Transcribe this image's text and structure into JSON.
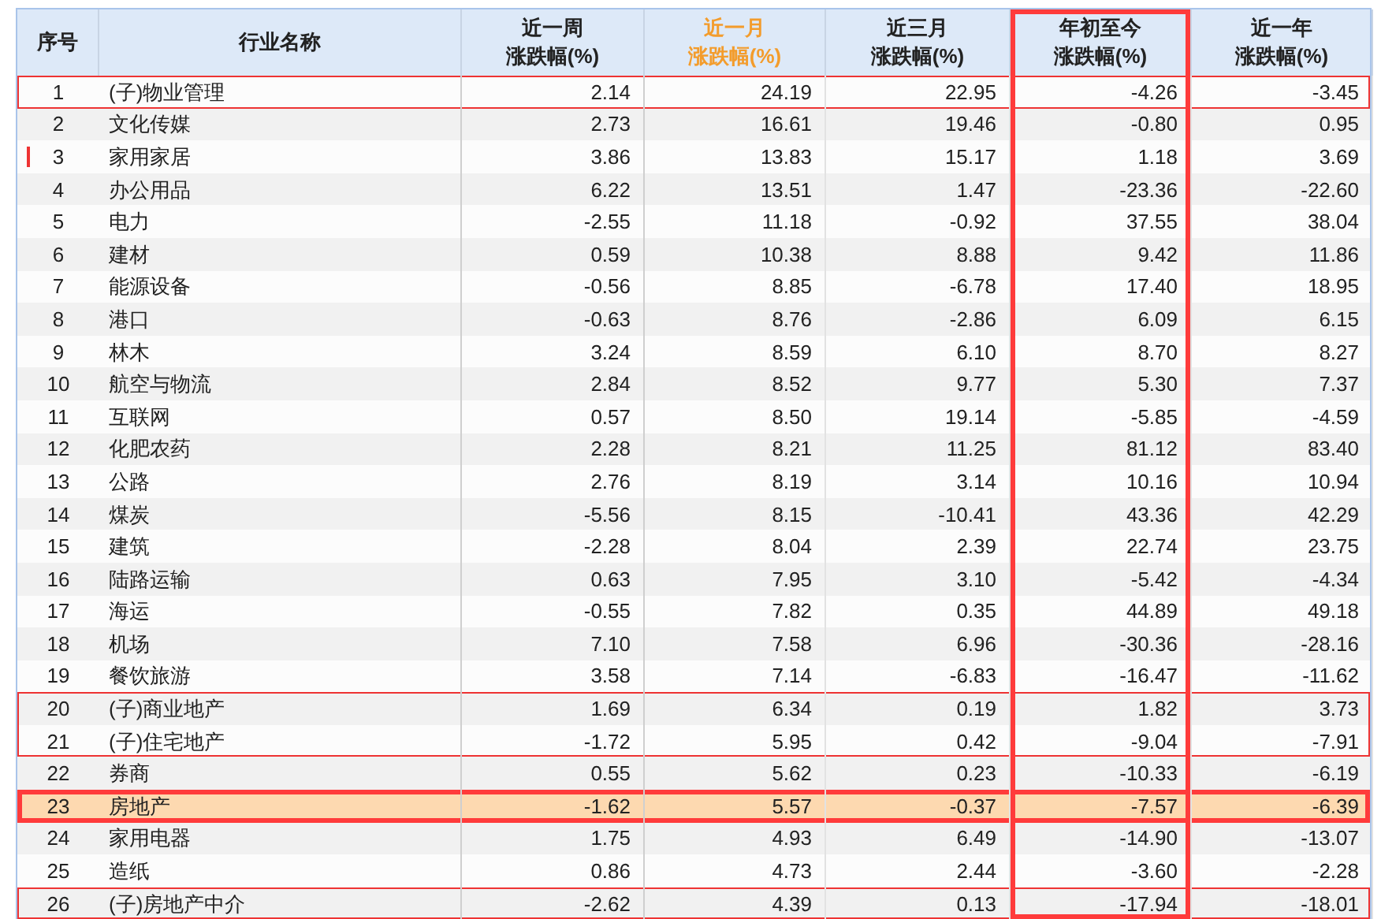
{
  "columns": [
    {
      "label": "序号",
      "sorted": false,
      "outlined": false
    },
    {
      "label": "行业名称",
      "sorted": false,
      "outlined": false
    },
    {
      "label": "近一周",
      "unit": "涨跌幅(%)",
      "sorted": false,
      "outlined": false
    },
    {
      "label": "近一月",
      "unit": "涨跌幅(%)",
      "sorted": true,
      "outlined": false
    },
    {
      "label": "近三月",
      "unit": "涨跌幅(%)",
      "sorted": false,
      "outlined": false
    },
    {
      "label": "年初至今",
      "unit": "涨跌幅(%)",
      "sorted": false,
      "outlined": true
    },
    {
      "label": "近一年",
      "unit": "涨跌幅(%)",
      "sorted": false,
      "outlined": false
    }
  ],
  "rows": [
    {
      "cells": [
        "1",
        "(子)物业管理",
        "2.14",
        "24.19",
        "22.95",
        "-4.26",
        "-3.45"
      ],
      "selected": false,
      "outlined": true,
      "bold_outline": false,
      "marked": false
    },
    {
      "cells": [
        "2",
        "文化传媒",
        "2.73",
        "16.61",
        "19.46",
        "-0.80",
        "0.95"
      ],
      "selected": false,
      "outlined": false,
      "bold_outline": false,
      "marked": false
    },
    {
      "cells": [
        "3",
        "家用家居",
        "3.86",
        "13.83",
        "15.17",
        "1.18",
        "3.69"
      ],
      "selected": false,
      "outlined": false,
      "bold_outline": false,
      "marked": true
    },
    {
      "cells": [
        "4",
        "办公用品",
        "6.22",
        "13.51",
        "1.47",
        "-23.36",
        "-22.60"
      ],
      "selected": false,
      "outlined": false,
      "bold_outline": false,
      "marked": false
    },
    {
      "cells": [
        "5",
        "电力",
        "-2.55",
        "11.18",
        "-0.92",
        "37.55",
        "38.04"
      ],
      "selected": false,
      "outlined": false,
      "bold_outline": false,
      "marked": false
    },
    {
      "cells": [
        "6",
        "建材",
        "0.59",
        "10.38",
        "8.88",
        "9.42",
        "11.86"
      ],
      "selected": false,
      "outlined": false,
      "bold_outline": false,
      "marked": false
    },
    {
      "cells": [
        "7",
        "能源设备",
        "-0.56",
        "8.85",
        "-6.78",
        "17.40",
        "18.95"
      ],
      "selected": false,
      "outlined": false,
      "bold_outline": false,
      "marked": false
    },
    {
      "cells": [
        "8",
        "港口",
        "-0.63",
        "8.76",
        "-2.86",
        "6.09",
        "6.15"
      ],
      "selected": false,
      "outlined": false,
      "bold_outline": false,
      "marked": false
    },
    {
      "cells": [
        "9",
        "林木",
        "3.24",
        "8.59",
        "6.10",
        "8.70",
        "8.27"
      ],
      "selected": false,
      "outlined": false,
      "bold_outline": false,
      "marked": false
    },
    {
      "cells": [
        "10",
        "航空与物流",
        "2.84",
        "8.52",
        "9.77",
        "5.30",
        "7.37"
      ],
      "selected": false,
      "outlined": false,
      "bold_outline": false,
      "marked": false
    },
    {
      "cells": [
        "11",
        "互联网",
        "0.57",
        "8.50",
        "19.14",
        "-5.85",
        "-4.59"
      ],
      "selected": false,
      "outlined": false,
      "bold_outline": false,
      "marked": false
    },
    {
      "cells": [
        "12",
        "化肥农药",
        "2.28",
        "8.21",
        "11.25",
        "81.12",
        "83.40"
      ],
      "selected": false,
      "outlined": false,
      "bold_outline": false,
      "marked": false
    },
    {
      "cells": [
        "13",
        "公路",
        "2.76",
        "8.19",
        "3.14",
        "10.16",
        "10.94"
      ],
      "selected": false,
      "outlined": false,
      "bold_outline": false,
      "marked": false
    },
    {
      "cells": [
        "14",
        "煤炭",
        "-5.56",
        "8.15",
        "-10.41",
        "43.36",
        "42.29"
      ],
      "selected": false,
      "outlined": false,
      "bold_outline": false,
      "marked": false
    },
    {
      "cells": [
        "15",
        "建筑",
        "-2.28",
        "8.04",
        "2.39",
        "22.74",
        "23.75"
      ],
      "selected": false,
      "outlined": false,
      "bold_outline": false,
      "marked": false
    },
    {
      "cells": [
        "16",
        "陆路运输",
        "0.63",
        "7.95",
        "3.10",
        "-5.42",
        "-4.34"
      ],
      "selected": false,
      "outlined": false,
      "bold_outline": false,
      "marked": false
    },
    {
      "cells": [
        "17",
        "海运",
        "-0.55",
        "7.82",
        "0.35",
        "44.89",
        "49.18"
      ],
      "selected": false,
      "outlined": false,
      "bold_outline": false,
      "marked": false
    },
    {
      "cells": [
        "18",
        "机场",
        "7.10",
        "7.58",
        "6.96",
        "-30.36",
        "-28.16"
      ],
      "selected": false,
      "outlined": false,
      "bold_outline": false,
      "marked": false
    },
    {
      "cells": [
        "19",
        "餐饮旅游",
        "3.58",
        "7.14",
        "-6.83",
        "-16.47",
        "-11.62"
      ],
      "selected": false,
      "outlined": false,
      "bold_outline": false,
      "marked": false
    },
    {
      "cells": [
        "20",
        "(子)商业地产",
        "1.69",
        "6.34",
        "0.19",
        "1.82",
        "3.73"
      ],
      "selected": false,
      "outlined": true,
      "bold_outline": false,
      "marked": false
    },
    {
      "cells": [
        "21",
        "(子)住宅地产",
        "-1.72",
        "5.95",
        "0.42",
        "-9.04",
        "-7.91"
      ],
      "selected": false,
      "outlined": true,
      "bold_outline": false,
      "marked": false
    },
    {
      "cells": [
        "22",
        "券商",
        "0.55",
        "5.62",
        "0.23",
        "-10.33",
        "-6.19"
      ],
      "selected": false,
      "outlined": false,
      "bold_outline": false,
      "marked": false
    },
    {
      "cells": [
        "23",
        "房地产",
        "-1.62",
        "5.57",
        "-0.37",
        "-7.57",
        "-6.39"
      ],
      "selected": true,
      "outlined": true,
      "bold_outline": true,
      "marked": false
    },
    {
      "cells": [
        "24",
        "家用电器",
        "1.75",
        "4.93",
        "6.49",
        "-14.90",
        "-13.07"
      ],
      "selected": false,
      "outlined": false,
      "bold_outline": false,
      "marked": false
    },
    {
      "cells": [
        "25",
        "造纸",
        "0.86",
        "4.73",
        "2.44",
        "-3.60",
        "-2.28"
      ],
      "selected": false,
      "outlined": false,
      "bold_outline": false,
      "marked": false
    },
    {
      "cells": [
        "26",
        "(子)房地产中介",
        "-2.62",
        "4.39",
        "0.13",
        "-17.94",
        "-18.01"
      ],
      "selected": false,
      "outlined": true,
      "bold_outline": false,
      "marked": false
    }
  ]
}
